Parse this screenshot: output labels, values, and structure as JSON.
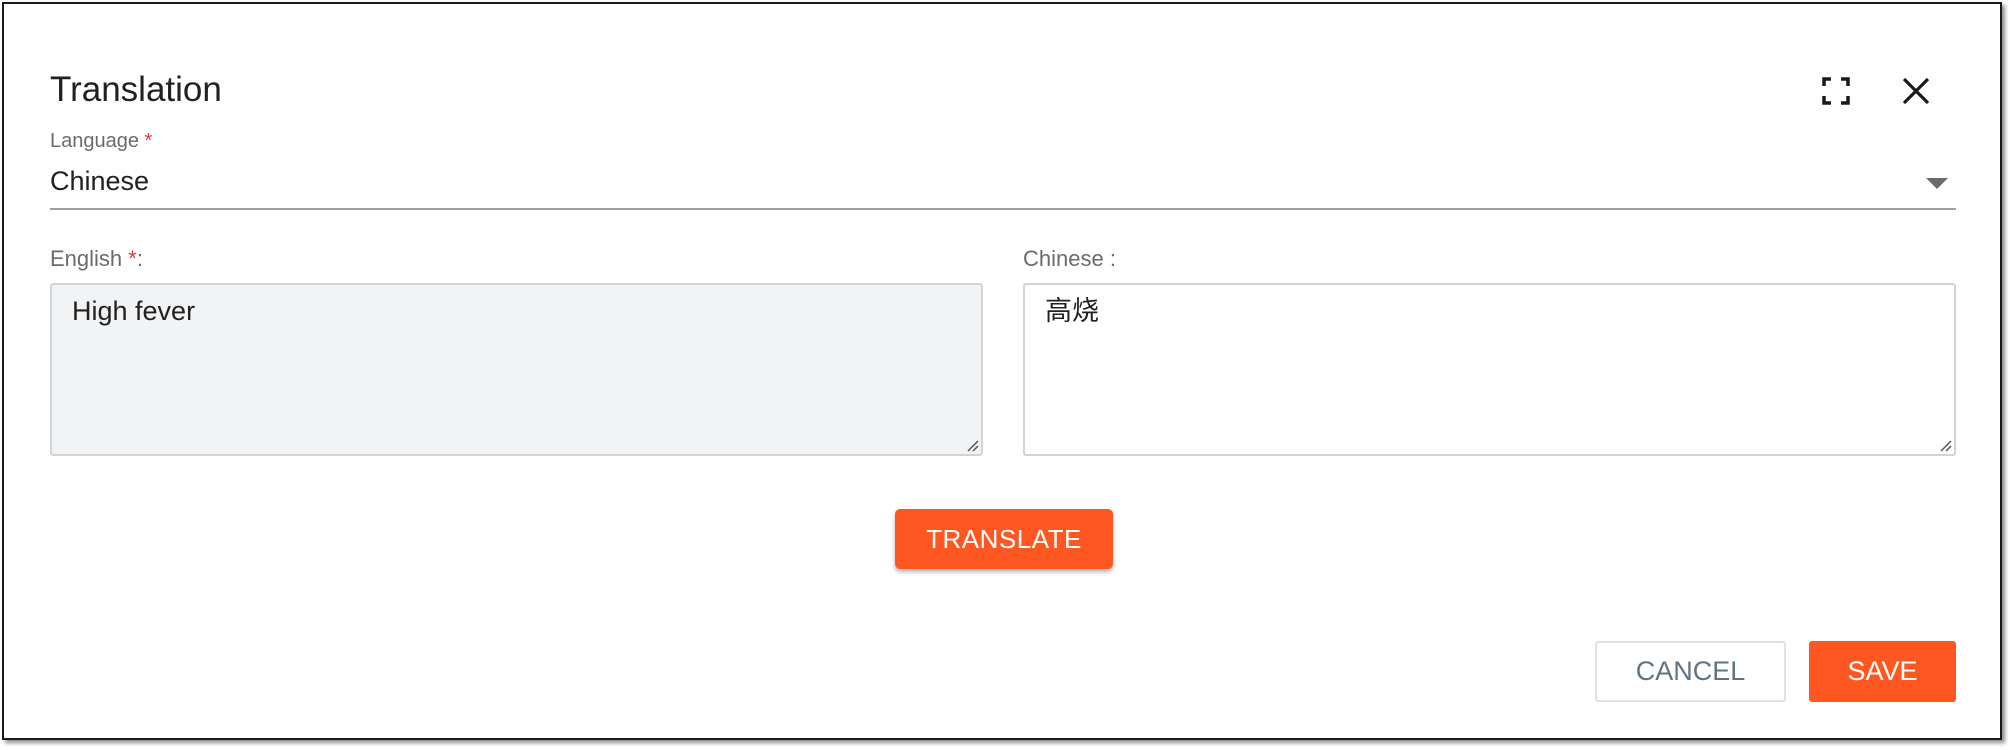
{
  "dialog": {
    "title": "Translation"
  },
  "icons": {
    "fullscreen": "fullscreen-icon",
    "close": "close-icon",
    "dropdown": "caret-down-icon"
  },
  "language": {
    "label": "Language",
    "required_marker": "*",
    "selected": "Chinese"
  },
  "source": {
    "label": "English",
    "required_marker": "*",
    "label_suffix": ":",
    "value": "High fever"
  },
  "target": {
    "label": "Chinese :",
    "value": "高烧"
  },
  "actions": {
    "translate_label": "TRANSLATE",
    "cancel_label": "CANCEL",
    "save_label": "SAVE"
  },
  "colors": {
    "accent": "#ff5722",
    "required": "#e53935",
    "source_background": "#f1f3f5"
  }
}
